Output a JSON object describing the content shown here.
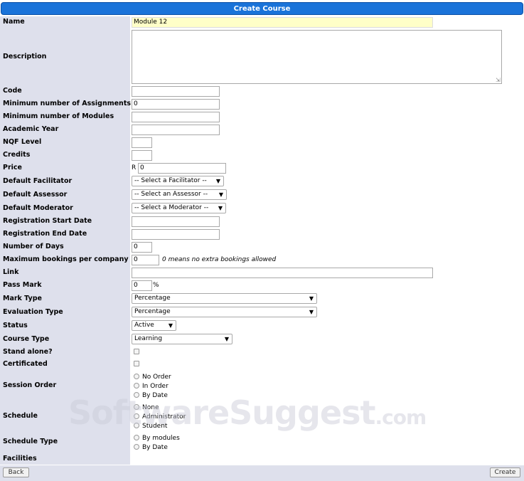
{
  "header": {
    "title": "Create Course"
  },
  "fields": {
    "name": {
      "label": "Name",
      "value": "Module 12"
    },
    "description": {
      "label": "Description",
      "value": ""
    },
    "code": {
      "label": "Code",
      "value": ""
    },
    "min_assignments": {
      "label": "Minimum number of Assignments",
      "value": "0"
    },
    "min_modules": {
      "label": "Minimum number of Modules",
      "value": ""
    },
    "academic_year": {
      "label": "Academic Year",
      "value": ""
    },
    "nqf_level": {
      "label": "NQF Level",
      "value": ""
    },
    "credits": {
      "label": "Credits",
      "value": ""
    },
    "price": {
      "label": "Price",
      "prefix": "R",
      "value": "0"
    },
    "facilitator": {
      "label": "Default Facilitator",
      "value": "-- Select a Facilitator --"
    },
    "assessor": {
      "label": "Default Assessor",
      "value": "-- Select an Assessor --"
    },
    "moderator": {
      "label": "Default Moderator",
      "value": "-- Select a Moderator --"
    },
    "reg_start": {
      "label": "Registration Start Date",
      "value": ""
    },
    "reg_end": {
      "label": "Registration End Date",
      "value": ""
    },
    "num_days": {
      "label": "Number of Days",
      "value": "0"
    },
    "max_bookings": {
      "label": "Maximum bookings per company",
      "value": "0",
      "hint": "0 means no extra bookings allowed"
    },
    "link": {
      "label": "Link",
      "value": ""
    },
    "pass_mark": {
      "label": "Pass Mark",
      "value": "0",
      "suffix": "%"
    },
    "mark_type": {
      "label": "Mark Type",
      "value": "Percentage"
    },
    "evaluation_type": {
      "label": "Evaluation Type",
      "value": "Percentage"
    },
    "status": {
      "label": "Status",
      "value": "Active"
    },
    "course_type": {
      "label": "Course Type",
      "value": "Learning"
    },
    "stand_alone": {
      "label": "Stand alone?"
    },
    "certificated": {
      "label": "Certificated"
    },
    "session_order": {
      "label": "Session Order",
      "options": [
        "No Order",
        "In Order",
        "By Date"
      ]
    },
    "schedule": {
      "label": "Schedule",
      "options": [
        "None",
        "Administrator",
        "Student"
      ]
    },
    "schedule_type": {
      "label": "Schedule Type",
      "options": [
        "By modules",
        "By Date"
      ]
    },
    "facilities": {
      "label": "Facilities"
    }
  },
  "footer": {
    "back_label": "Back",
    "create_label": "Create"
  },
  "watermark": {
    "main": "SoftwareSuggest",
    "suffix": ".com"
  },
  "colors": {
    "header_bg": "#1a73d9",
    "label_bg": "#dee0ec",
    "name_field_bg": "#ffffc8"
  },
  "icons": {
    "dropdown": "triangle-down",
    "radio": "radio-circle",
    "checkbox": "checkbox-square"
  }
}
